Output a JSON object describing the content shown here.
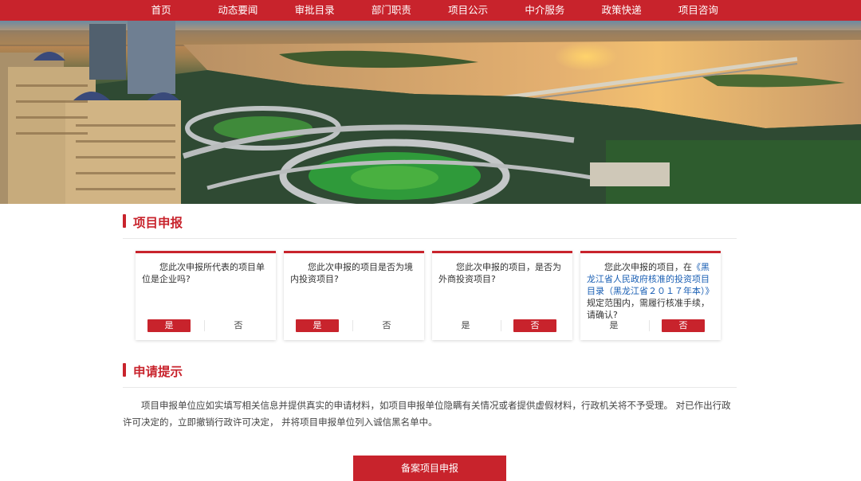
{
  "nav": {
    "items": [
      "首页",
      "动态要闻",
      "审批目录",
      "部门职责",
      "项目公示",
      "中介服务",
      "政策快递",
      "项目咨询"
    ]
  },
  "sections": {
    "project_declare": "项目申报",
    "application_tips": "申请提示"
  },
  "questions": [
    {
      "text": "您此次申报所代表的项目单位是企业吗?",
      "yes": "是",
      "no": "否",
      "selected": "yes"
    },
    {
      "text": "您此次申报的项目是否为境内投资项目?",
      "yes": "是",
      "no": "否",
      "selected": "yes"
    },
    {
      "text": "您此次申报的项目，是否为外商投资项目?",
      "yes": "是",
      "no": "否",
      "selected": "no"
    },
    {
      "text_prefix": "您此次申报的项目，在",
      "text_link": "《黑龙江省人民政府核准的投资项目目录（黑龙江省２０１７年本）》",
      "text_suffix": "规定范围内，需履行核准手续，请确认?",
      "yes": "是",
      "no": "否",
      "selected": "no"
    }
  ],
  "notice": "项目申报单位应如实填写相关信息并提供真实的申请材料，如项目申报单位隐瞒有关情况或者提供虚假材料，行政机关将不予受理。 对已作出行政许可决定的，立即撤销行政许可决定， 并将项目申报单位列入诚信黑名单中。",
  "submit_label": "备案项目申报",
  "colors": {
    "accent": "#c8232c",
    "link": "#1a5fb4"
  }
}
